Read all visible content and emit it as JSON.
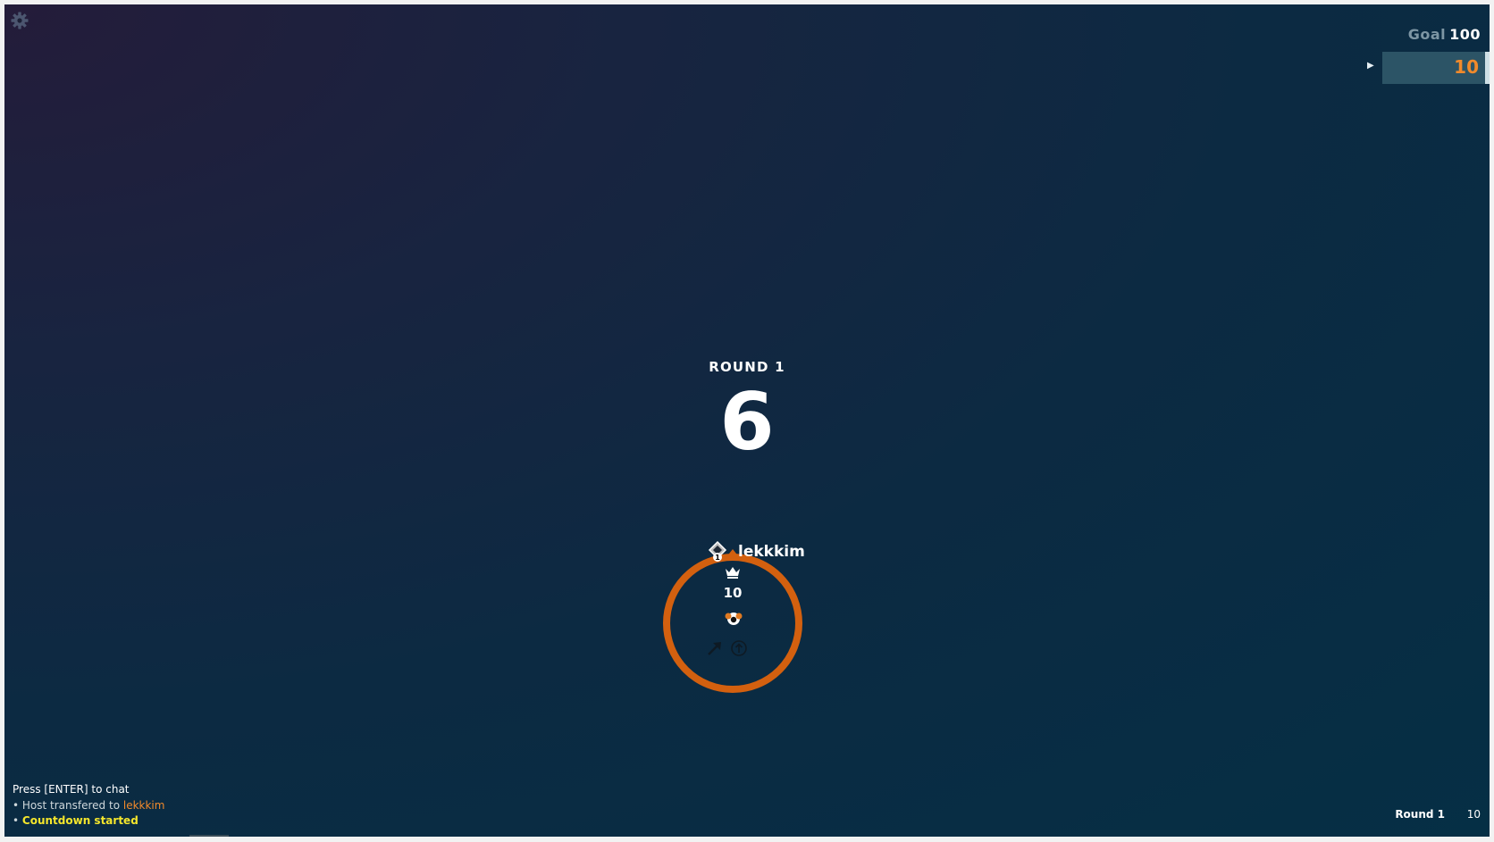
{
  "goal": {
    "label": "Goal",
    "value": "100"
  },
  "scoreboard": {
    "marker": "▶",
    "rows": [
      {
        "score": "10",
        "color": "#f18a2b",
        "highlighted": true
      }
    ]
  },
  "countdown": {
    "round_label": "ROUND 1",
    "value": "6"
  },
  "player": {
    "name": "lekkkim",
    "score": "10",
    "ring_color": "#d3600f",
    "is_host": true,
    "host_badge_number": "1",
    "icons": [
      "crown-icon",
      "player-avatar-icon",
      "arrow-icon",
      "up-circle-icon"
    ]
  },
  "chat": {
    "hint": "Press [ENTER] to chat",
    "messages": [
      {
        "prefix": "• ",
        "text": "Host transfered to ",
        "name": "lekkkim",
        "style": "info"
      },
      {
        "prefix": "• ",
        "text": "Countdown started",
        "style": "highlight",
        "color": "#f5e62c"
      }
    ]
  },
  "status": {
    "round": "Round 1",
    "score": "10"
  },
  "icons": {
    "settings": "gear-icon"
  }
}
